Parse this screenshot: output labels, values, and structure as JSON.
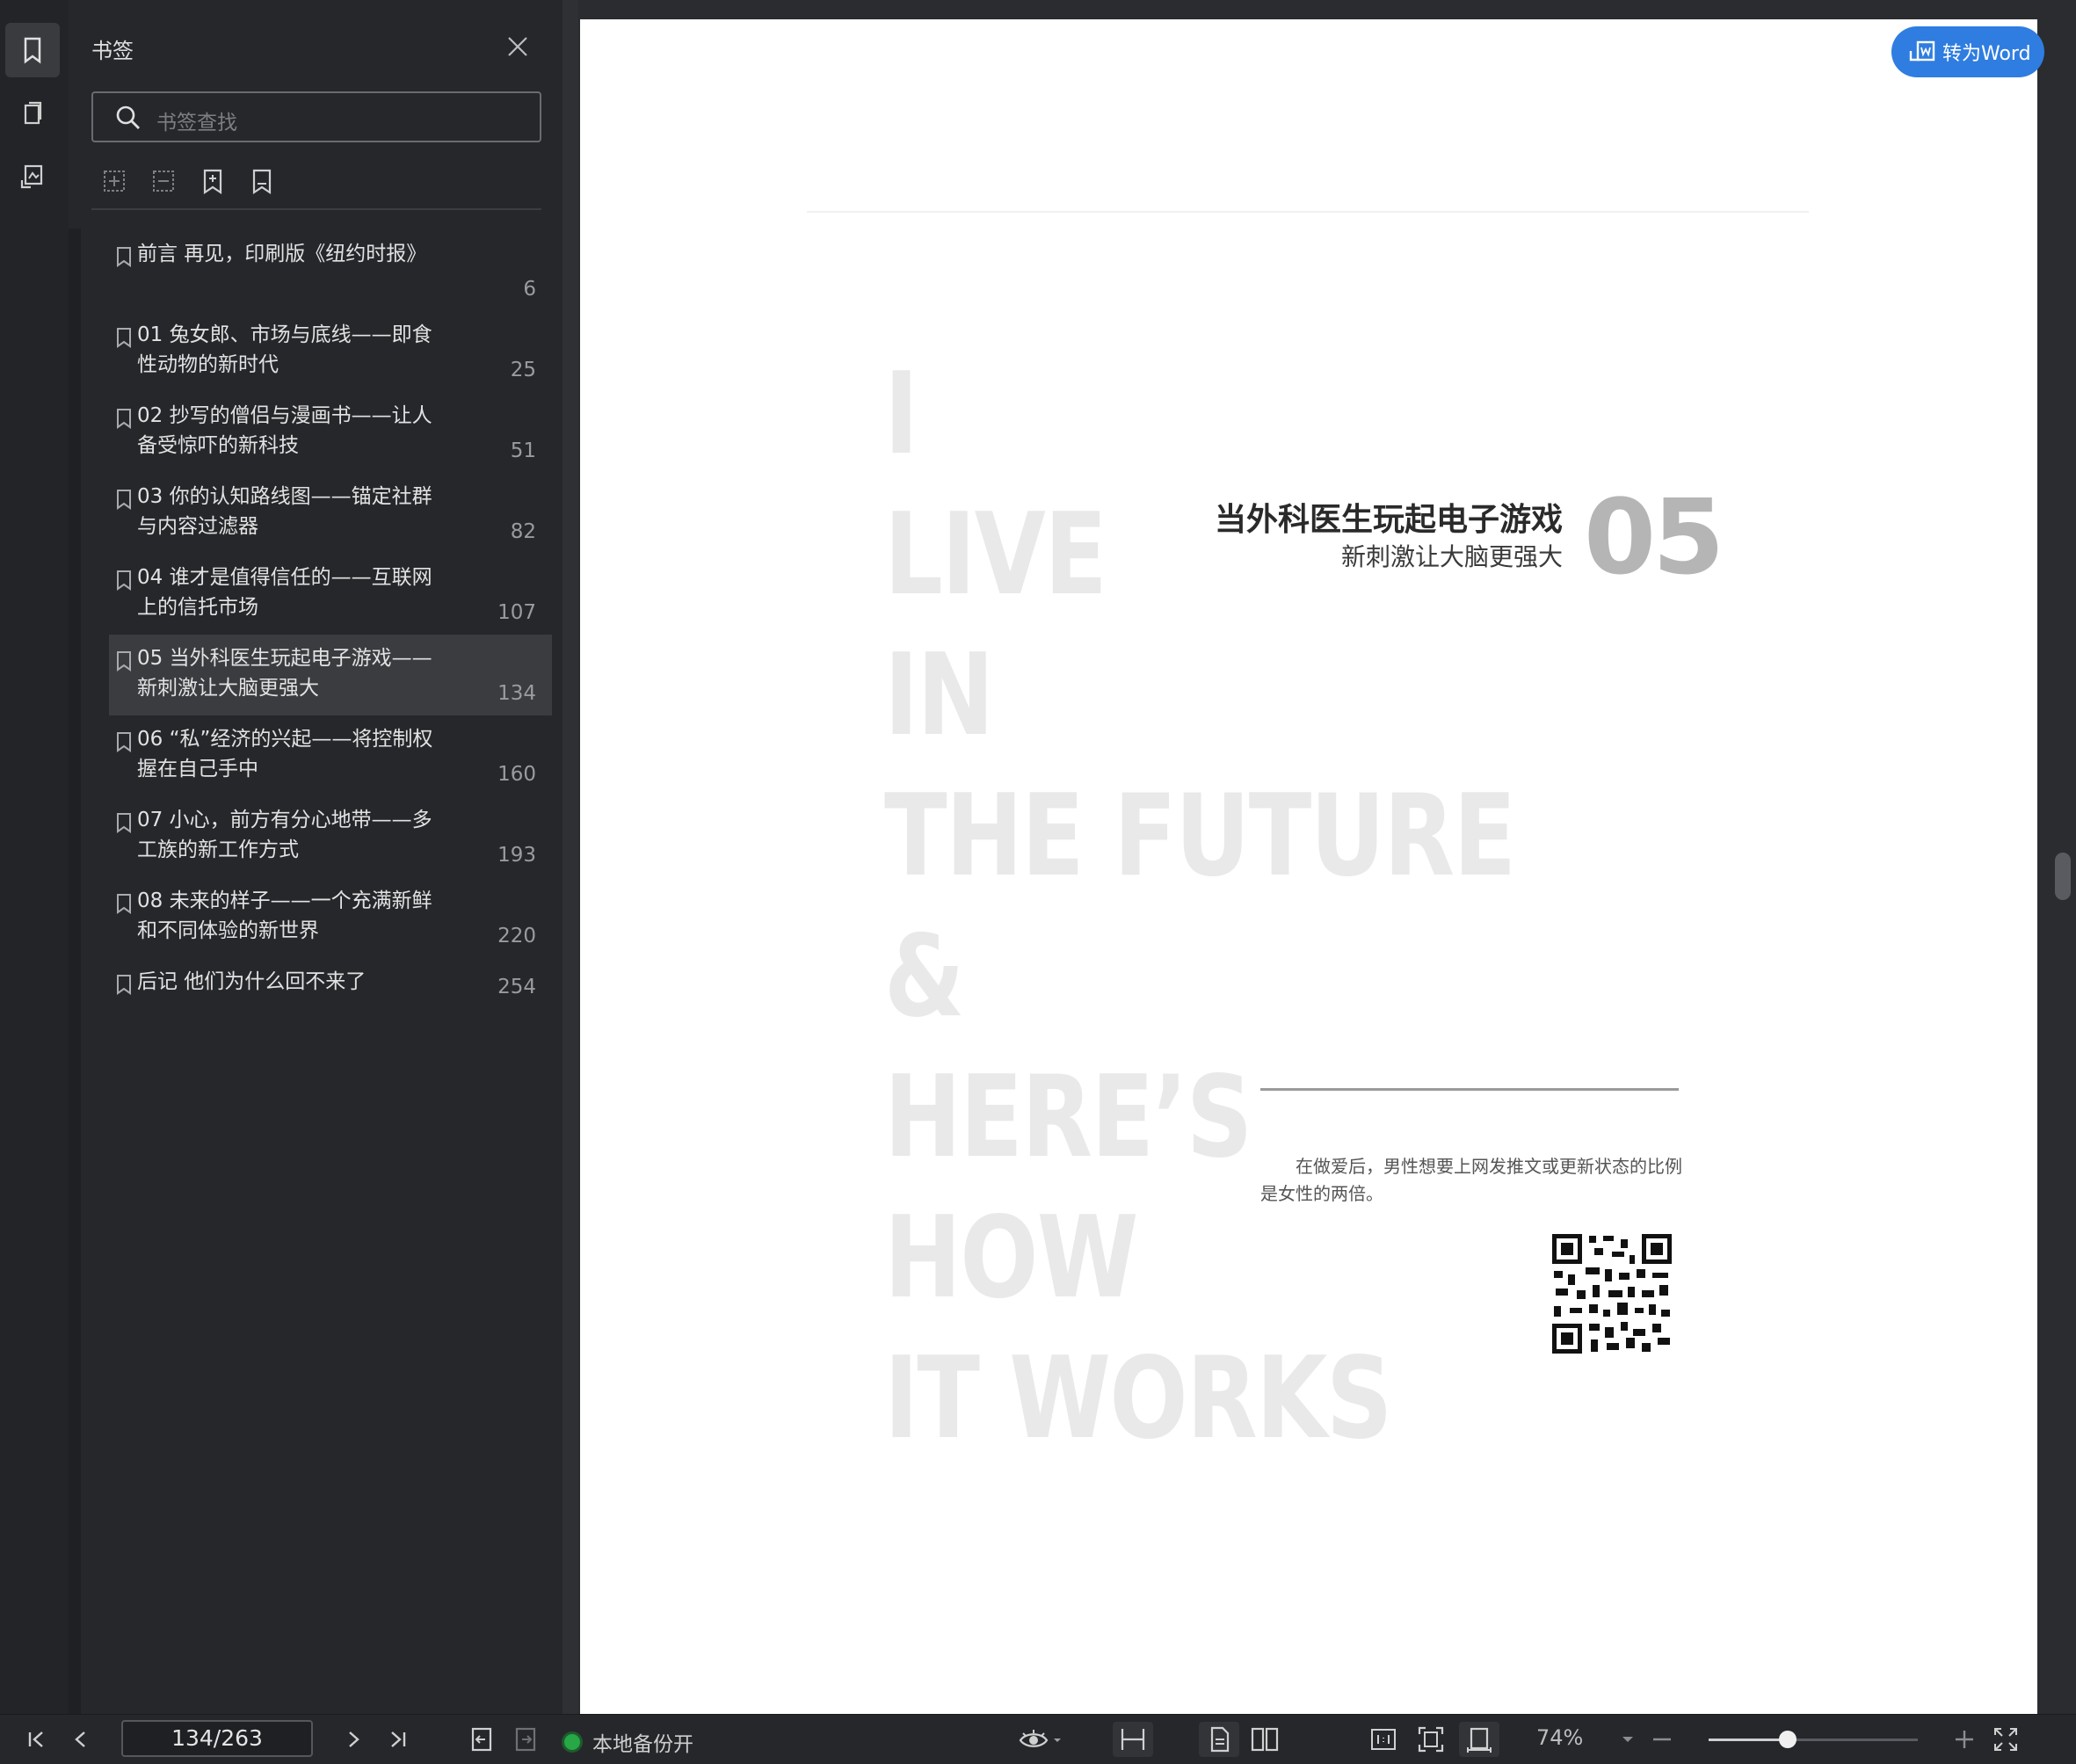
{
  "sidebar": {
    "title": "书签",
    "search_placeholder": "书签查找",
    "items": [
      {
        "label": "前言 再见，印刷版《纽约时报》",
        "page": "6"
      },
      {
        "label": "01 兔女郎、市场与底线——即食性动物的新时代",
        "page": "25"
      },
      {
        "label": "02 抄写的僧侣与漫画书——让人备受惊吓的新科技",
        "page": "51"
      },
      {
        "label": "03 你的认知路线图——锚定社群与内容过滤器",
        "page": "82"
      },
      {
        "label": "04 谁才是值得信任的——互联网上的信托市场",
        "page": "107"
      },
      {
        "label": "05 当外科医生玩起电子游戏——新刺激让大脑更强大",
        "page": "134"
      },
      {
        "label": "06 “私”经济的兴起——将控制权握在自己手中",
        "page": "160"
      },
      {
        "label": "07 小心，前方有分心地带——多工族的新工作方式",
        "page": "193"
      },
      {
        "label": "08 未来的样子——一个充满新鲜和不同体验的新世界",
        "page": "220"
      },
      {
        "label": "后记 他们为什么回不来了",
        "page": "254"
      }
    ],
    "selected_index": 5
  },
  "document": {
    "big_lines": [
      "I",
      "LIVE",
      "IN",
      "THE FUTURE",
      "&",
      "HERE’S",
      "HOW",
      "IT WORKS"
    ],
    "chapter_title": "当外科医生玩起电子游戏",
    "chapter_subtitle": "新刺激让大脑更强大",
    "chapter_number": "05",
    "quote": "在做爱后，男性想要上网发推文或更新状态的比例是女性的两倍。"
  },
  "toolbar": {
    "convert_label": "转为Word",
    "page_indicator": "134/263",
    "backup_label": "本地备份开",
    "zoom": "74%",
    "zoom_fraction": 0.38
  },
  "colors": {
    "accent": "#2f7de0",
    "status_green": "#27a745"
  }
}
